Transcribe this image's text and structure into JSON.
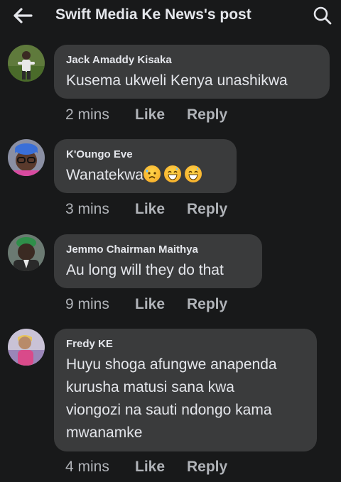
{
  "header": {
    "title": "Swift Media Ke News's post",
    "back_icon": "arrow-left-icon",
    "search_icon": "search-icon"
  },
  "comments": [
    {
      "author": "Jack Amaddy Kisaka",
      "text": "Kusema ukweli Kenya unashikwa",
      "time": "2 mins",
      "like": "Like",
      "reply": "Reply"
    },
    {
      "author": "K'Oungo Eve",
      "text": "Wanatekwa",
      "emojis": [
        "sad-sweat-face-icon",
        "grinning-sweat-face-icon",
        "grinning-sweat-face-icon"
      ],
      "time": "3 mins",
      "like": "Like",
      "reply": "Reply"
    },
    {
      "author": "Jemmo Chairman Maithya",
      "text": "Au long will they do that",
      "time": "9 mins",
      "like": "Like",
      "reply": "Reply"
    },
    {
      "author": "Fredy KE",
      "text_lines": [
        "Huyu shoga afungwe anapenda",
        "kurusha matusi sana kwa",
        "viongozi na sauti ndongo kama",
        "mwanamke"
      ],
      "time": "4 mins",
      "like": "Like",
      "reply": "Reply"
    }
  ],
  "colors": {
    "background": "#18191a",
    "bubble": "#3a3b3c",
    "primary_text": "#e4e6eb",
    "secondary_text": "#b0b3b8"
  }
}
